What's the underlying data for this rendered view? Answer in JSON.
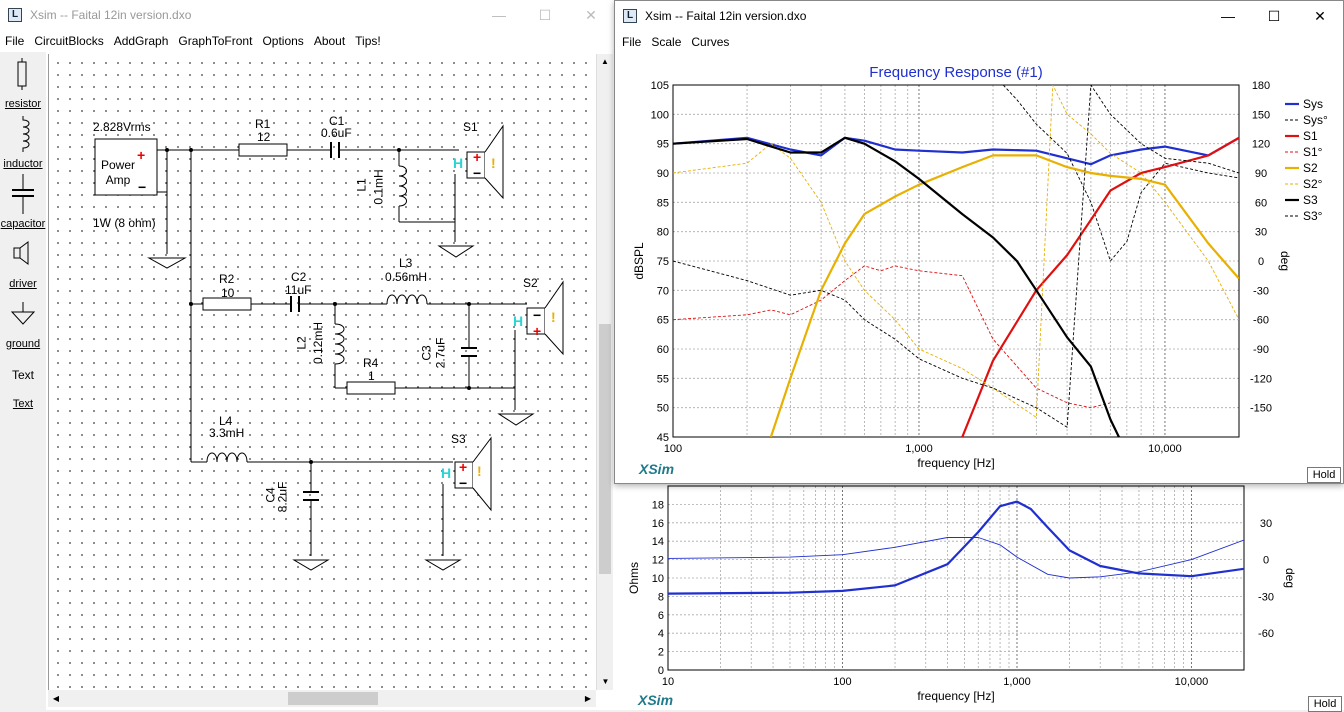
{
  "schematic_window": {
    "title": "Xsim -- Faital 12in version.dxo",
    "menu": [
      "File",
      "CircuitBlocks",
      "AddGraph",
      "GraphToFront",
      "Options",
      "About",
      "Tips!"
    ],
    "tools": [
      "resistor",
      "inductor",
      "capacitor",
      "driver",
      "ground",
      "Text",
      "Text"
    ],
    "amp": {
      "voltage": "2.828Vrms",
      "name": "Power Amp",
      "power": "1W (8 ohm)"
    },
    "components": {
      "r1_name": "R1",
      "r1_val": "12",
      "c1_name": "C1",
      "c1_val": "0.6uF",
      "l1_name": "L1",
      "l1_val": "0.1mH",
      "s1": "S1",
      "r2_name": "R2",
      "r2_val": "10",
      "c2_name": "C2",
      "c2_val": "11uF",
      "l3_name": "L3",
      "l3_val": "0.56mH",
      "s2": "S2",
      "l2_name": "L2",
      "l2_val": "0.12mH",
      "c3_name": "C3",
      "c3_val": "2.7uF",
      "r4_name": "R4",
      "r4_val": "1",
      "l4_name": "L4",
      "l4_val": "3.3mH",
      "s3": "S3",
      "c4_name": "C4",
      "c4_val": "8.2uF"
    }
  },
  "graph_window": {
    "title": "Xsim -- Faital 12in version.dxo",
    "menu": [
      "File",
      "Scale",
      "Curves"
    ],
    "hold_label": "Hold",
    "logo": "XSim",
    "window_controls": {
      "minimize": "—",
      "maximize": "☐",
      "close": "✕"
    }
  },
  "impedance_window": {
    "hold_label": "Hold",
    "logo": "XSim"
  },
  "chart_data": [
    {
      "type": "line",
      "title": "Frequency Response (#1)",
      "xlabel": "frequency [Hz]",
      "ylabel": "dBSPL",
      "y2label": "deg",
      "xscale": "log",
      "xlim": [
        100,
        20000
      ],
      "ylim": [
        45,
        105
      ],
      "y2lim": [
        -180,
        180
      ],
      "xticks": [
        "100",
        "1,000",
        "10,000"
      ],
      "yticks": [
        "105",
        "100",
        "95",
        "90",
        "85",
        "80",
        "75",
        "70",
        "65",
        "60",
        "55",
        "50",
        "45"
      ],
      "y2ticks": [
        "180",
        "150",
        "120",
        "90",
        "60",
        "30",
        "0",
        "-30",
        "-60",
        "-90",
        "-120",
        "-150"
      ],
      "grid": true,
      "legend_position": "right",
      "colors": {
        "sys": "#1f2fd0",
        "s1": "#e01010",
        "s2": "#e8b000",
        "s3": "#000000"
      },
      "series": [
        {
          "name": "Sys",
          "axis": "left",
          "style": "solid-thick",
          "color": "#1f2fd0",
          "x": [
            100,
            200,
            300,
            400,
            500,
            600,
            800,
            1000,
            1500,
            2000,
            3000,
            4000,
            5000,
            6000,
            8000,
            10000,
            15000,
            20000
          ],
          "y": [
            95,
            96,
            94,
            93,
            96,
            95.5,
            94,
            93.8,
            93.5,
            94,
            93.8,
            92.5,
            91.5,
            93,
            94,
            94.5,
            93,
            96
          ]
        },
        {
          "name": "Sys°",
          "axis": "right",
          "style": "dashed-thin",
          "color": "#000000",
          "x": [
            2200,
            2500,
            3000,
            4000,
            5000,
            6000,
            7000,
            8000,
            10000,
            15000,
            20000
          ],
          "y": [
            180,
            165,
            140,
            110,
            60,
            0,
            20,
            70,
            100,
            90,
            85
          ]
        },
        {
          "name": "S1",
          "axis": "left",
          "style": "solid-thick",
          "color": "#e01010",
          "x": [
            1500,
            2000,
            3000,
            4000,
            5000,
            6000,
            8000,
            10000,
            15000,
            20000
          ],
          "y": [
            45,
            58,
            70,
            76,
            82,
            87,
            90,
            91,
            93,
            96
          ]
        },
        {
          "name": "S1°",
          "axis": "right",
          "style": "dashed-thin",
          "color": "#e01010",
          "x": [
            100,
            200,
            250,
            300,
            400,
            500,
            600,
            700,
            800,
            1000,
            1500,
            2000,
            3000,
            4000,
            5000,
            6000
          ],
          "y": [
            -60,
            -55,
            -50,
            -55,
            -40,
            -20,
            -5,
            -10,
            -5,
            -10,
            -15,
            -80,
            -130,
            -145,
            -150,
            -145
          ]
        },
        {
          "name": "S2",
          "axis": "left",
          "style": "solid-thick",
          "color": "#e8b000",
          "x": [
            250,
            300,
            400,
            500,
            600,
            800,
            1000,
            1500,
            2000,
            3000,
            4000,
            5000,
            6000,
            8000,
            10000,
            15000,
            20000
          ],
          "y": [
            45,
            55,
            70,
            78,
            83,
            86,
            88,
            91,
            93,
            93,
            91,
            90,
            89.5,
            89,
            88,
            78,
            72
          ]
        },
        {
          "name": "S2°",
          "axis": "right",
          "style": "dashed-thin",
          "color": "#e8b000",
          "x": [
            100,
            200,
            250,
            300,
            400,
            500,
            600,
            800,
            1000,
            1500,
            2000,
            3000,
            3500,
            4000,
            5000,
            6000,
            8000,
            10000,
            15000,
            20000
          ],
          "y": [
            90,
            100,
            120,
            105,
            60,
            0,
            -30,
            -60,
            -90,
            -110,
            -130,
            -160,
            180,
            150,
            130,
            110,
            90,
            60,
            0,
            -60
          ]
        },
        {
          "name": "S3",
          "axis": "left",
          "style": "solid-thick",
          "color": "#000000",
          "x": [
            100,
            200,
            300,
            400,
            500,
            600,
            800,
            1000,
            1500,
            2000,
            2500,
            3000,
            4000,
            5000,
            6000,
            6500
          ],
          "y": [
            95,
            95.8,
            93.5,
            93.5,
            96,
            95,
            92,
            89,
            83,
            79,
            75,
            70,
            62,
            57,
            48,
            45
          ]
        },
        {
          "name": "S3°",
          "axis": "right",
          "style": "dashed-thin",
          "color": "#000000",
          "x": [
            100,
            200,
            300,
            400,
            500,
            600,
            800,
            1000,
            1500,
            2000,
            3000,
            4000,
            5000,
            6000,
            8000,
            10000,
            15000,
            20000
          ],
          "y": [
            0,
            -20,
            -35,
            -30,
            -40,
            -60,
            -80,
            -100,
            -120,
            -130,
            -150,
            -170,
            180,
            150,
            120,
            105,
            100,
            90
          ]
        }
      ]
    },
    {
      "type": "line",
      "title": "",
      "xlabel": "frequency [Hz]",
      "ylabel": "Ohms",
      "y2label": "deg",
      "xscale": "log",
      "xlim": [
        10,
        20000
      ],
      "ylim": [
        0,
        20
      ],
      "y2lim": [
        -90,
        60
      ],
      "xticks": [
        "10",
        "100",
        "1,000",
        "10,000"
      ],
      "yticks": [
        "18",
        "16",
        "14",
        "12",
        "10",
        "8",
        "6",
        "4",
        "2",
        "0"
      ],
      "y2ticks": [
        "30",
        "0",
        "-30",
        "-60"
      ],
      "grid": true,
      "series": [
        {
          "axis": "left",
          "style": "solid-thick",
          "color": "#1f2fd0",
          "x": [
            10,
            50,
            100,
            200,
            400,
            600,
            800,
            1000,
            1200,
            1500,
            2000,
            3000,
            5000,
            10000,
            20000
          ],
          "y": [
            8.3,
            8.4,
            8.6,
            9.2,
            11.5,
            15,
            17.8,
            18.3,
            17.5,
            15.5,
            13,
            11.3,
            10.5,
            10.2,
            11
          ]
        },
        {
          "axis": "right",
          "style": "solid-thin",
          "color": "#1f2fd0",
          "x": [
            10,
            50,
            100,
            200,
            400,
            600,
            800,
            1000,
            1500,
            2000,
            3000,
            5000,
            10000,
            20000
          ],
          "y": [
            1,
            2,
            4,
            10,
            18,
            18,
            12,
            2,
            -12,
            -15,
            -14,
            -10,
            0,
            16
          ]
        }
      ]
    }
  ]
}
